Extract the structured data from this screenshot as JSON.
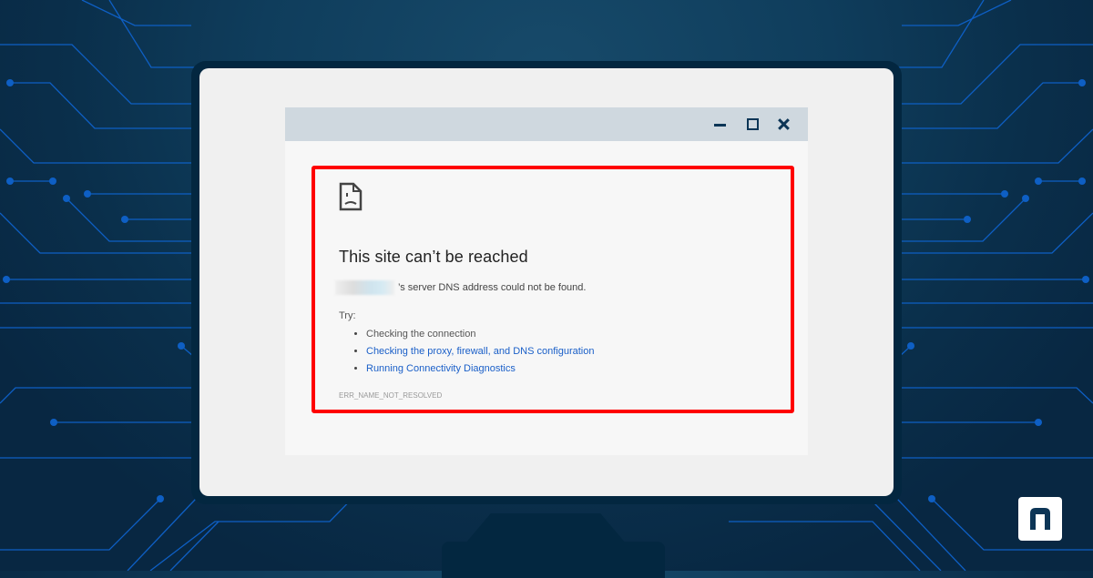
{
  "colors": {
    "background": "#0f3d5c",
    "circuit_line": "#0e5fc4",
    "monitor_frame": "#032740",
    "screen": "#f0f0f0",
    "titlebar": "#cfd8df",
    "highlight_border": "#ff0000",
    "link": "#1a5fc8"
  },
  "window": {
    "controls": [
      {
        "name": "minimize",
        "icon": "minimize-icon"
      },
      {
        "name": "maximize",
        "icon": "maximize-icon"
      },
      {
        "name": "close",
        "icon": "close-icon"
      }
    ]
  },
  "error_page": {
    "icon": "sad-page-icon",
    "title": "This site can’t be reached",
    "domain_redacted": "",
    "message": "’s  server DNS address could not be found.",
    "try_label": "Try:",
    "suggestions": [
      {
        "text": "Checking the connection",
        "link": false
      },
      {
        "text": "Checking the proxy, firewall, and DNS configuration",
        "link": true
      },
      {
        "text": "Running Connectivity Diagnostics",
        "link": true
      }
    ],
    "error_code": "ERR_NAME_NOT_RESOLVED"
  },
  "branding": {
    "logo_letter": "n",
    "logo_icon": "ninjaone-logo-icon"
  }
}
